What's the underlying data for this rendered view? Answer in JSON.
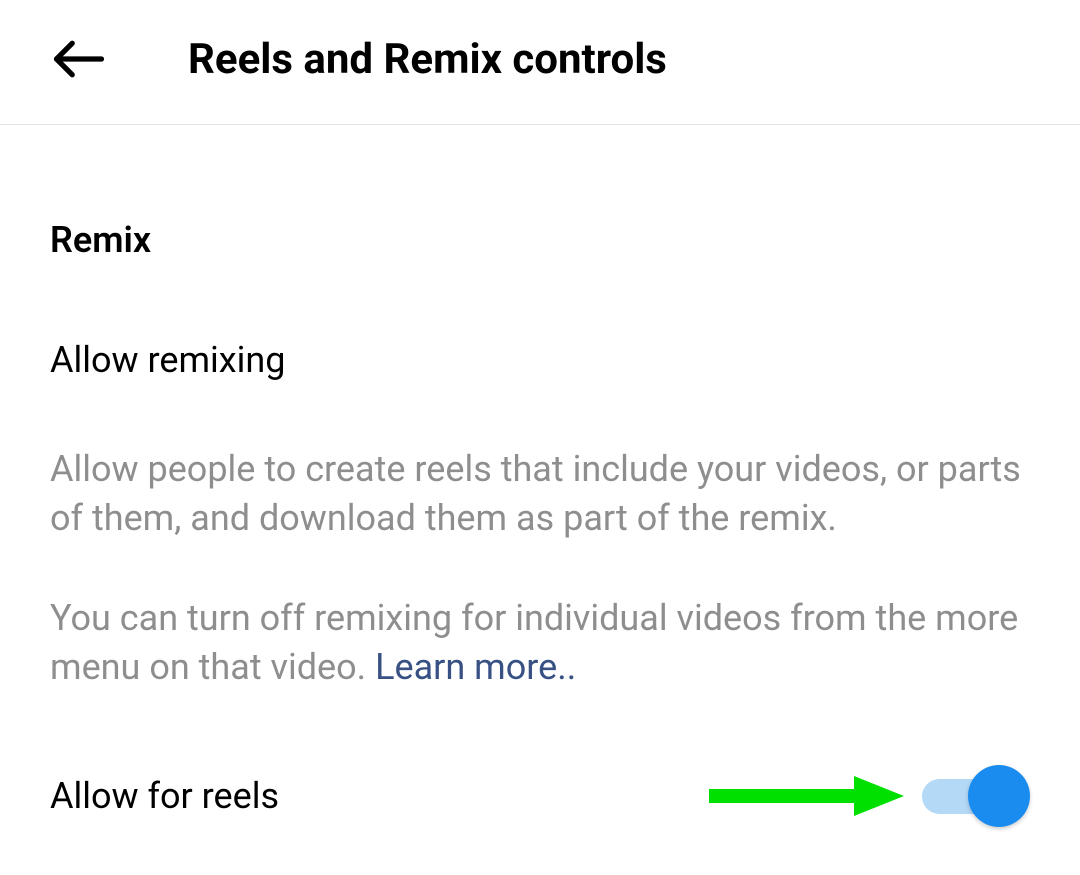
{
  "header": {
    "title": "Reels and Remix controls"
  },
  "section": {
    "heading": "Remix",
    "setting_title": "Allow remixing",
    "description1": "Allow people to create reels that include your videos, or parts of them, and download them as part of the remix.",
    "description2_prefix": "You can turn off remixing for individual videos from the more menu on that video. ",
    "learn_more": "Learn more..",
    "toggle_label": "Allow for reels",
    "toggle_on": true
  }
}
